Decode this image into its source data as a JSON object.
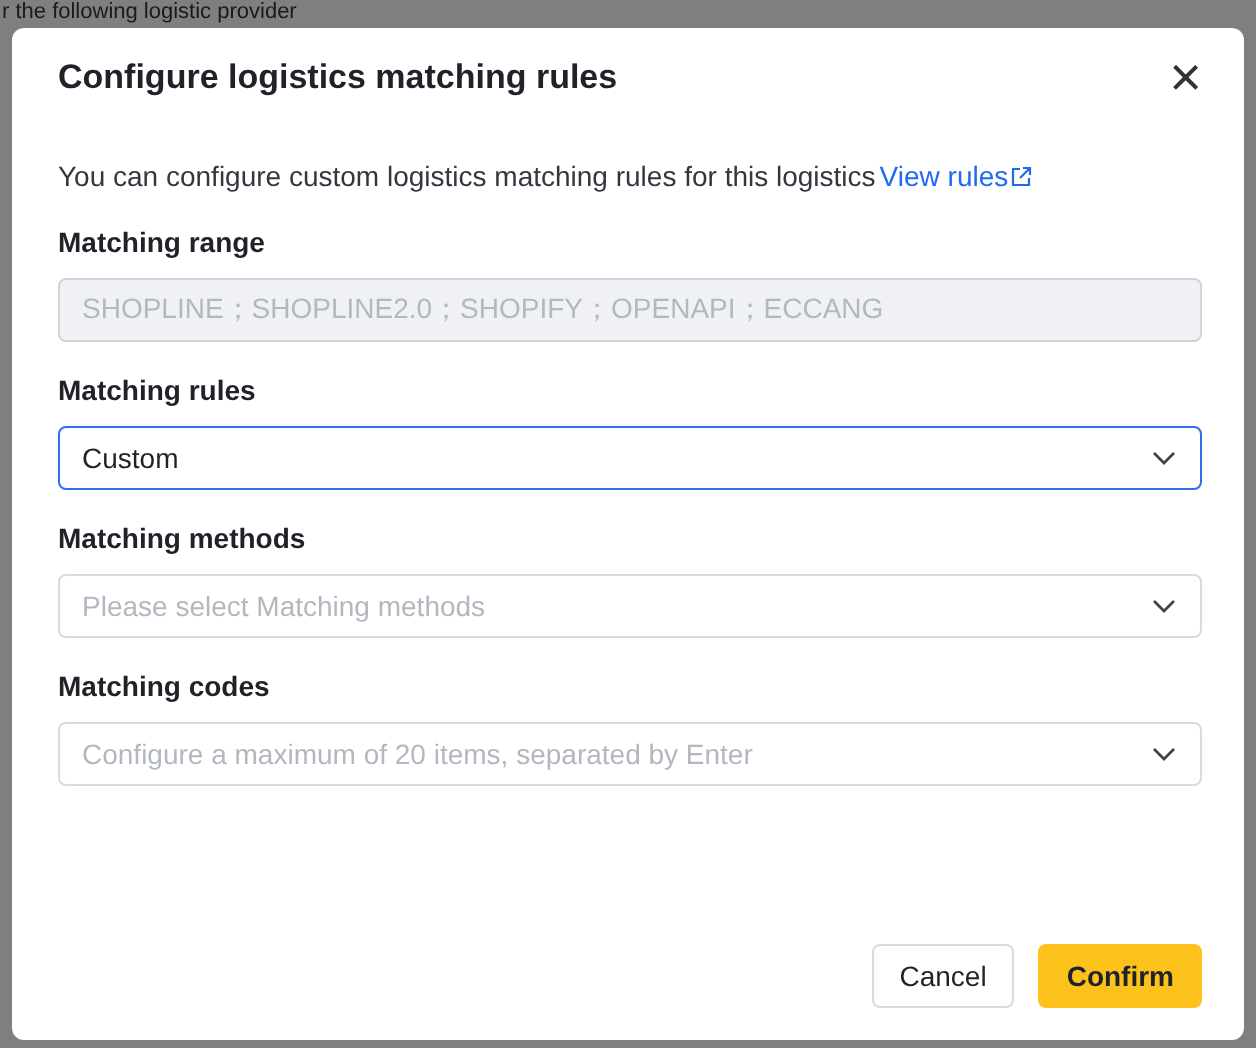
{
  "background": {
    "text": "r the following logistic provider"
  },
  "dialog": {
    "title": "Configure logistics matching rules",
    "close": "×",
    "description": {
      "text": "You can configure custom logistics matching rules for this logistics",
      "link": "View rules"
    },
    "fields": [
      {
        "label": "Matching range",
        "kind": "text",
        "value": "SHOPLINE；SHOPLINE2.0；SHOPIFY；OPENAPI；ECCANG",
        "disabled": true,
        "focused": false
      },
      {
        "label": "Matching rules",
        "kind": "select",
        "value": "Custom",
        "disabled": false,
        "focused": true
      },
      {
        "label": "Matching methods",
        "kind": "select",
        "placeholder": "Please select Matching methods",
        "disabled": false,
        "focused": false
      },
      {
        "label": "Matching codes",
        "kind": "select",
        "placeholder": "Configure a maximum of 20 items, separated by Enter",
        "disabled": false,
        "focused": false
      }
    ],
    "buttons": [
      {
        "label": "Cancel",
        "kind": "secondary"
      },
      {
        "label": "Confirm",
        "kind": "primary"
      }
    ]
  }
}
